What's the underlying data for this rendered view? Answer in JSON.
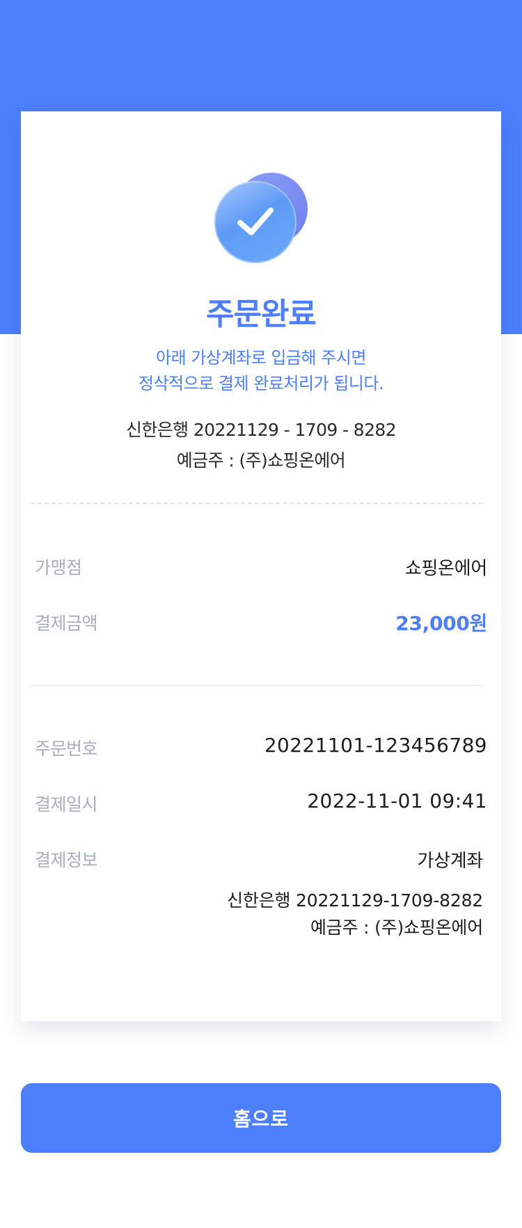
{
  "header": {
    "title": "주문완료",
    "notice_line1": "아래 가상계좌로 입금해 주시면",
    "notice_line2": "정삭적으로 결제 완료처리가 됩니다."
  },
  "account_summary": {
    "bank_account": "신한은행 20221129 - 1709 - 8282",
    "depositor": "예금주 : (주)쇼핑온에어"
  },
  "payment": {
    "merchant_label": "가맹점",
    "merchant_value": "쇼핑온에어",
    "amount_label": "결제금액",
    "amount_value": "23,000원"
  },
  "order": {
    "order_no_label": "주문번호",
    "order_no_value": "20221101-123456789",
    "date_label": "결제일시",
    "date_value": "2022-11-01 09:41",
    "method_label": "결제정보",
    "method_value": "가상계좌",
    "method_account": "신한은행 20221129-1709-8282",
    "method_depositor": "예금주 : (주)쇼핑온에어"
  },
  "actions": {
    "home_label": "홈으로"
  },
  "colors": {
    "accent": "#4d7efc",
    "label_gray": "#a7aeb8",
    "text_dark": "#1d1d1d"
  },
  "icons": {
    "success": "check-circle-icon"
  }
}
